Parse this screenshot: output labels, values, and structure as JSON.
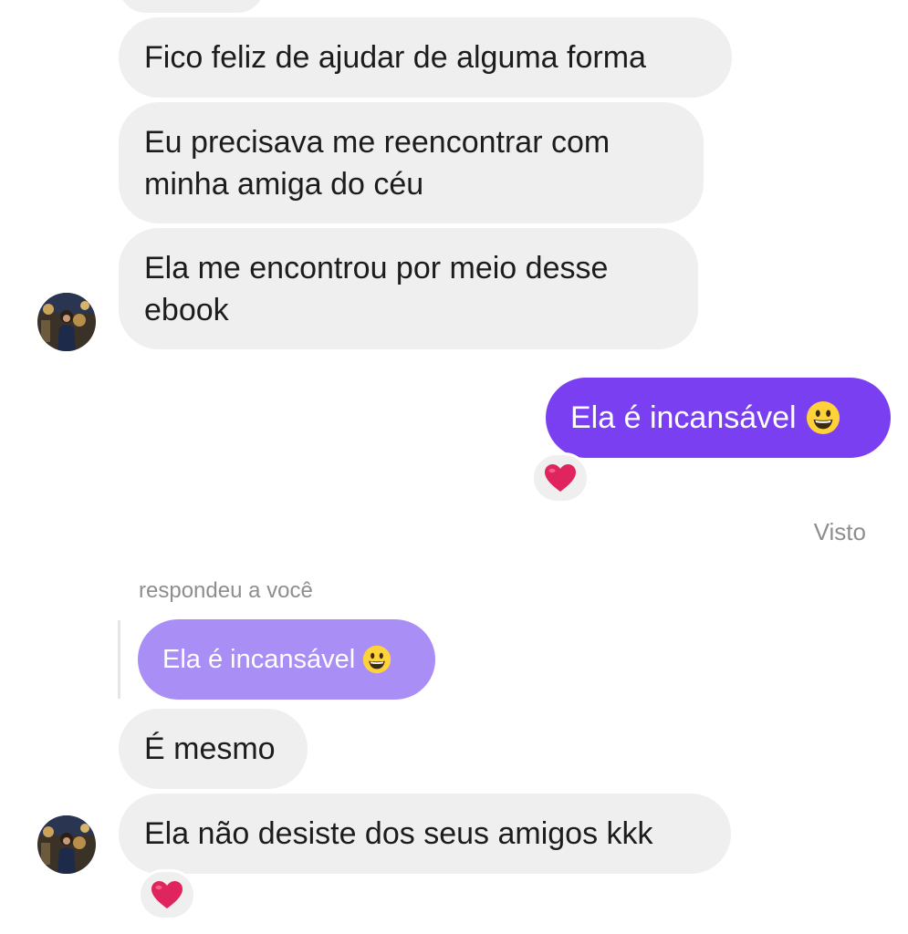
{
  "messages": {
    "m1": "Fico feliz de ajudar de alguma forma",
    "m2_line1": "Eu precisava me reencontrar com",
    "m2_line2": "minha amiga do céu",
    "m3_line1": "Ela me encontrou por meio desse",
    "m3_line2": "ebook",
    "outgoing": "Ela é incansável",
    "seen": "Visto",
    "replied_label": "respondeu a você",
    "quoted": "Ela é incansável",
    "m4": "É mesmo",
    "m5": "Ela não desiste dos seus amigos kkk"
  },
  "icons": {
    "reaction": "heart-icon",
    "emoji": "grinning-face-icon"
  },
  "colors": {
    "outgoing_bubble": "#7b3ff2",
    "quoted_bubble": "#a98ef5",
    "incoming_bubble": "#efefef",
    "heart": "#e0245e"
  }
}
